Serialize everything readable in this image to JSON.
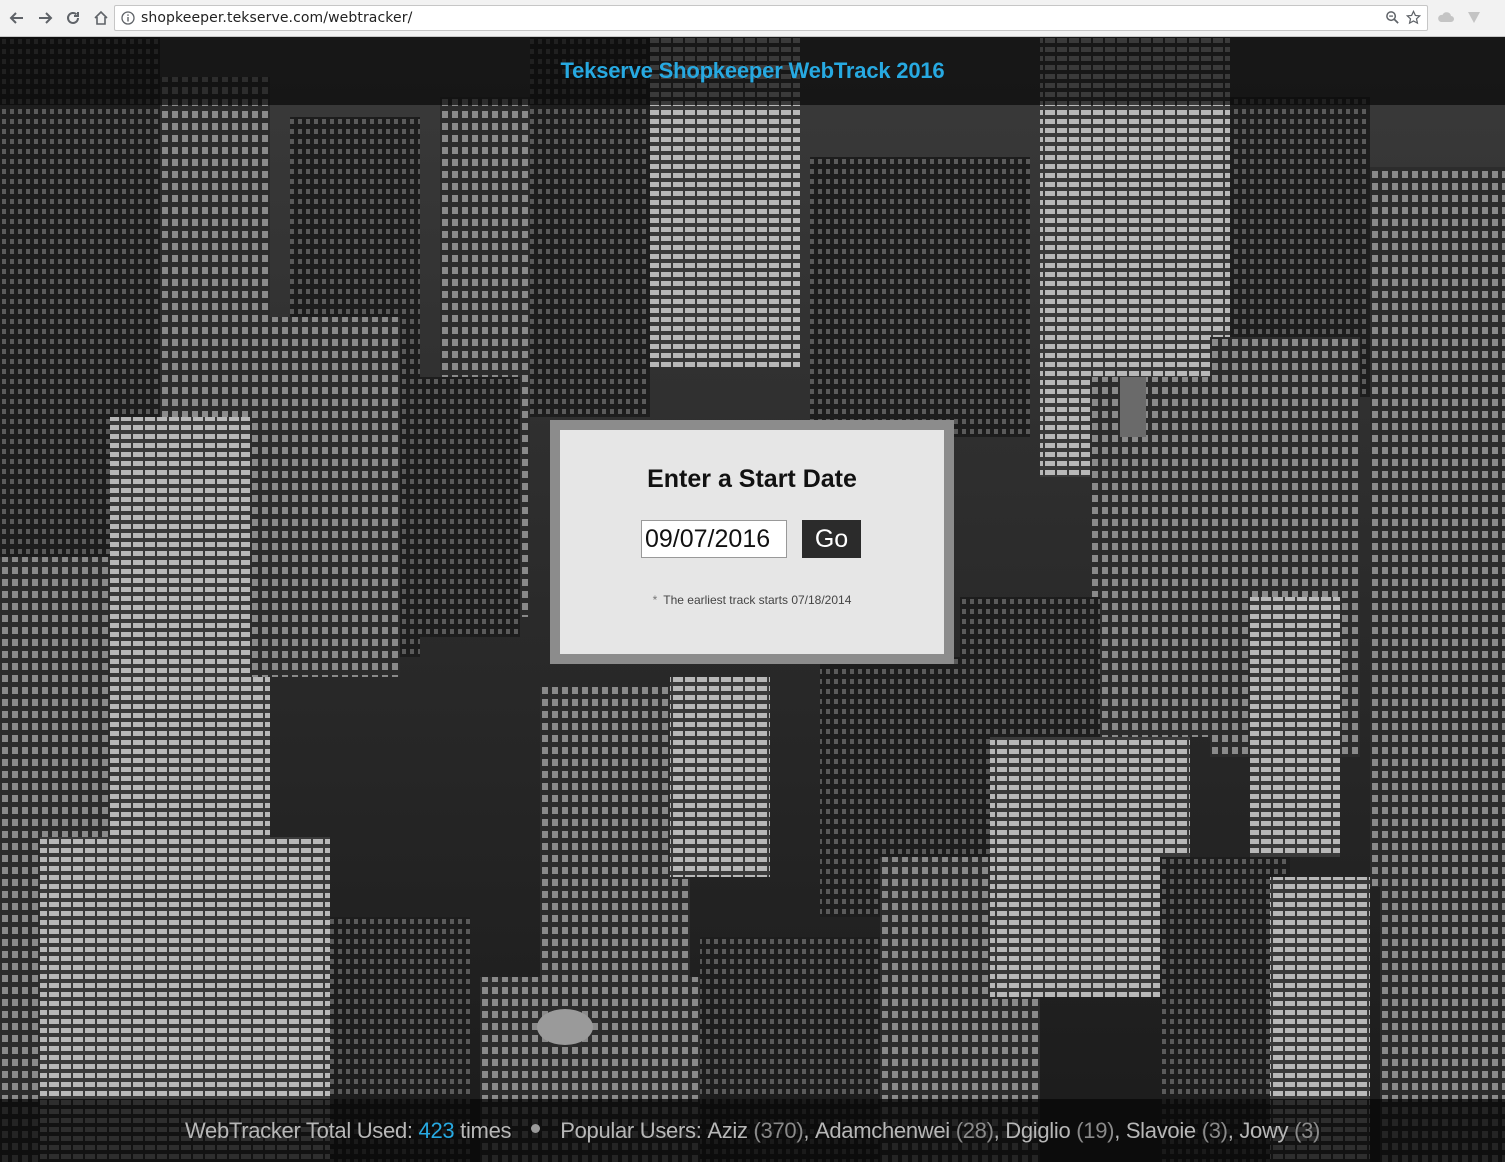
{
  "browser": {
    "url": "shopkeeper.tekserve.com/webtracker/",
    "icons": [
      "back-icon",
      "forward-icon",
      "reload-icon",
      "home-icon",
      "info-icon",
      "zoom-icon",
      "star-icon",
      "cloud-icon",
      "extension-icon"
    ]
  },
  "header": {
    "title": "Tekserve Shopkeeper WebTrack 2016",
    "accent": "#27a9e1"
  },
  "form": {
    "heading": "Enter a Start Date",
    "date_value": "09/07/2016",
    "go_label": "Go",
    "note_marker": "*",
    "note_text": "The earliest track starts 07/18/2014"
  },
  "footer": {
    "total_label": "WebTracker Total Used:",
    "total_count": "423",
    "total_suffix": "times",
    "popular_label": "Popular Users:",
    "users": [
      {
        "name": "Aziz",
        "count": "(370)"
      },
      {
        "name": "Adamchenwei",
        "count": "(28)"
      },
      {
        "name": "Dgiglio",
        "count": "(19)"
      },
      {
        "name": "Slavoie",
        "count": "(3)"
      },
      {
        "name": "Jowy",
        "count": "(3)"
      }
    ]
  }
}
